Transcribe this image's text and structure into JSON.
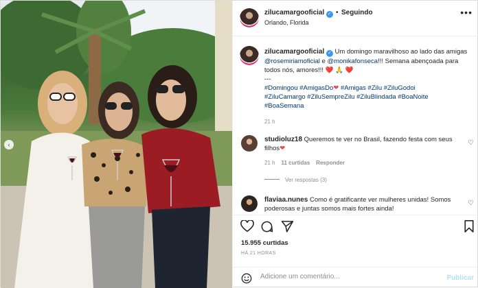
{
  "post": {
    "username": "zilucamargooficial",
    "follow_separator": "•",
    "follow_status": "Seguindo",
    "location": "Orlando, Florida",
    "more_icon": "more-horizontal-icon"
  },
  "caption": {
    "username": "zilucamargooficial",
    "text_1": "Um domingo maravilhoso ao lado das amigas",
    "mention_1": "@rosemiriamoficial",
    "conj": "e",
    "mention_2": "@monikafonseca",
    "text_2": "!!! Semana abençoada para todos nós, amores!!!",
    "emoji": "❤️ 🙏 ❤️",
    "dashes": "---",
    "hashtags_1": "#Domingou #AmigasDo",
    "heart_inline": "❤",
    "hashtags_2": "#Amigas #Zilu #ZiluGodoi",
    "hashtags_3": "#ZiluCamargo #ZiluSempreZilu #ZiluBlindada #BoaNoite",
    "hashtags_4": "#BoaSemana",
    "time": "21 h"
  },
  "comments": [
    {
      "username": "studioluz18",
      "text": "Queremos te ver no Brasil, fazendo festa com seus filhos",
      "emoji": "❤",
      "time": "21 h",
      "likes": "11 curtidas",
      "reply": "Responder",
      "replies": "Ver respostas (3)"
    },
    {
      "username": "flaviaa.nunes",
      "text": "Como é gratificante ver mulheres unidas! Somos poderosas e juntas somos mais fortes ainda!"
    }
  ],
  "stats": {
    "likes": "15.955 curtidas",
    "time_ago": "HÁ 21 HORAS"
  },
  "add_comment": {
    "placeholder": "Adicione um comentário...",
    "publish": "Publicar"
  },
  "colors": {
    "link": "#00376b",
    "verified": "#3897f0",
    "heart": "#ed4956",
    "muted": "#8e8e8e",
    "publish": "#b2dffc"
  }
}
